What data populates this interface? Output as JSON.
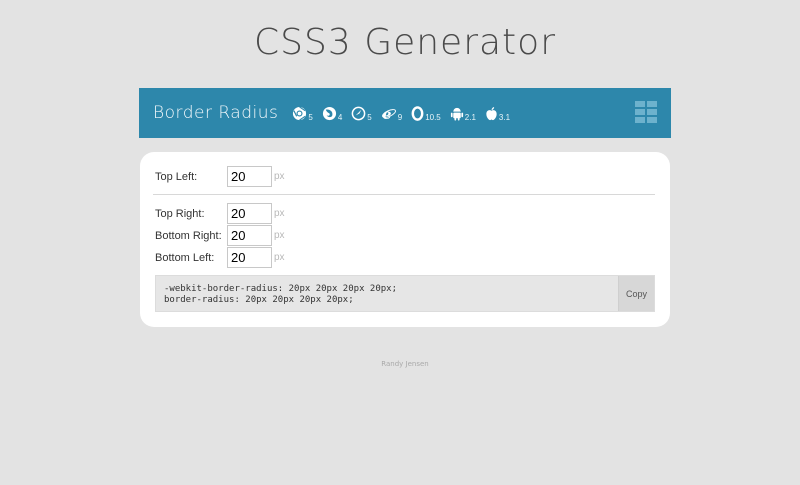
{
  "page": {
    "title": "CSS3 Generator",
    "author": "Randy Jensen"
  },
  "header": {
    "title": "Border Radius",
    "accent_color": "#2d87ab",
    "browsers": [
      {
        "icon": "chrome-icon",
        "version": "5"
      },
      {
        "icon": "firefox-icon",
        "version": "4"
      },
      {
        "icon": "safari-icon",
        "version": "5"
      },
      {
        "icon": "ie-icon",
        "version": "9"
      },
      {
        "icon": "opera-icon",
        "version": "10.5"
      },
      {
        "icon": "android-icon",
        "version": "2.1"
      },
      {
        "icon": "apple-icon",
        "version": "3.1"
      }
    ],
    "menu_icon": "grid-menu-icon"
  },
  "form": {
    "top_left": {
      "label": "Top Left:",
      "value": "20",
      "unit": "px"
    },
    "top_right": {
      "label": "Top Right:",
      "value": "20",
      "unit": "px"
    },
    "bottom_right": {
      "label": "Bottom Right:",
      "value": "20",
      "unit": "px"
    },
    "bottom_left": {
      "label": "Bottom Left:",
      "value": "20",
      "unit": "px"
    }
  },
  "output": {
    "code": "-webkit-border-radius: 20px 20px 20px 20px;\nborder-radius: 20px 20px 20px 20px;",
    "copy_label": "Copy"
  }
}
